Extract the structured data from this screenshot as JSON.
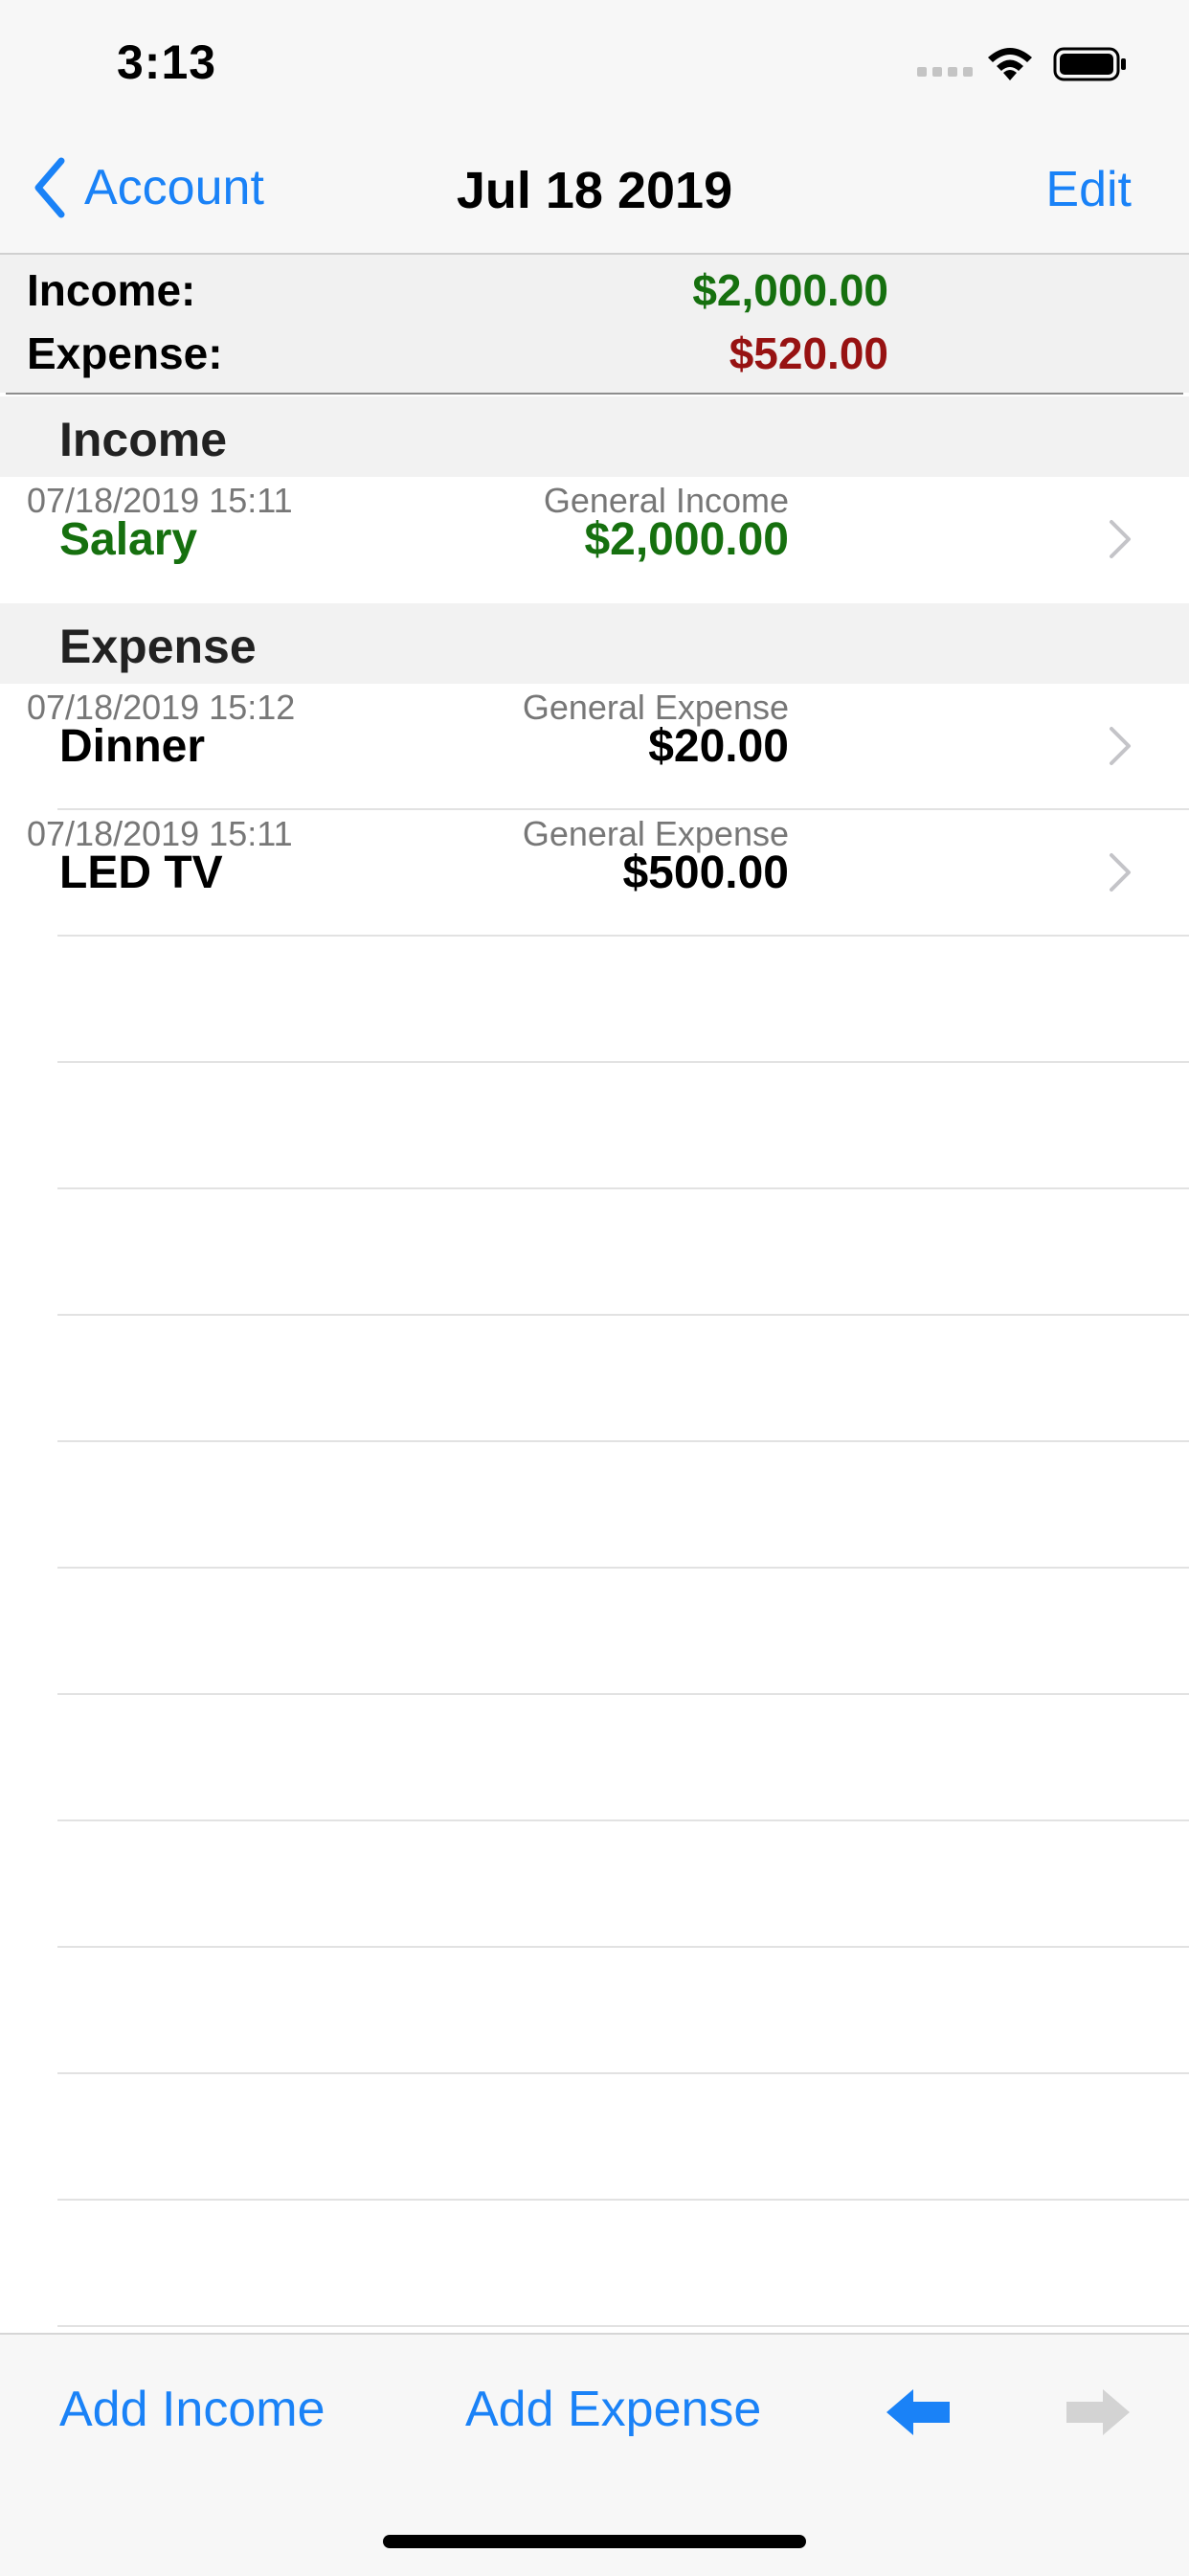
{
  "status_bar": {
    "time": "3:13"
  },
  "nav": {
    "back_label": "Account",
    "title": "Jul 18 2019",
    "edit_label": "Edit"
  },
  "summary": {
    "income_label": "Income:",
    "income_value": "$2,000.00",
    "expense_label": "Expense:",
    "expense_value": "$520.00"
  },
  "colors": {
    "accent": "#1a82f7",
    "income": "#16700f",
    "expense": "#971212"
  },
  "sections": [
    {
      "title": "Income",
      "rows": [
        {
          "timestamp": "07/18/2019 15:11",
          "category": "General Income",
          "name": "Salary",
          "amount": "$2,000.00"
        }
      ]
    },
    {
      "title": "Expense",
      "rows": [
        {
          "timestamp": "07/18/2019 15:12",
          "category": "General Expense",
          "name": "Dinner",
          "amount": "$20.00"
        },
        {
          "timestamp": "07/18/2019 15:11",
          "category": "General Expense",
          "name": "LED TV",
          "amount": "$500.00"
        }
      ]
    }
  ],
  "toolbar": {
    "add_income_label": "Add Income",
    "add_expense_label": "Add Expense",
    "prev_icon": "arrow-left-icon",
    "next_icon": "arrow-right-icon"
  }
}
